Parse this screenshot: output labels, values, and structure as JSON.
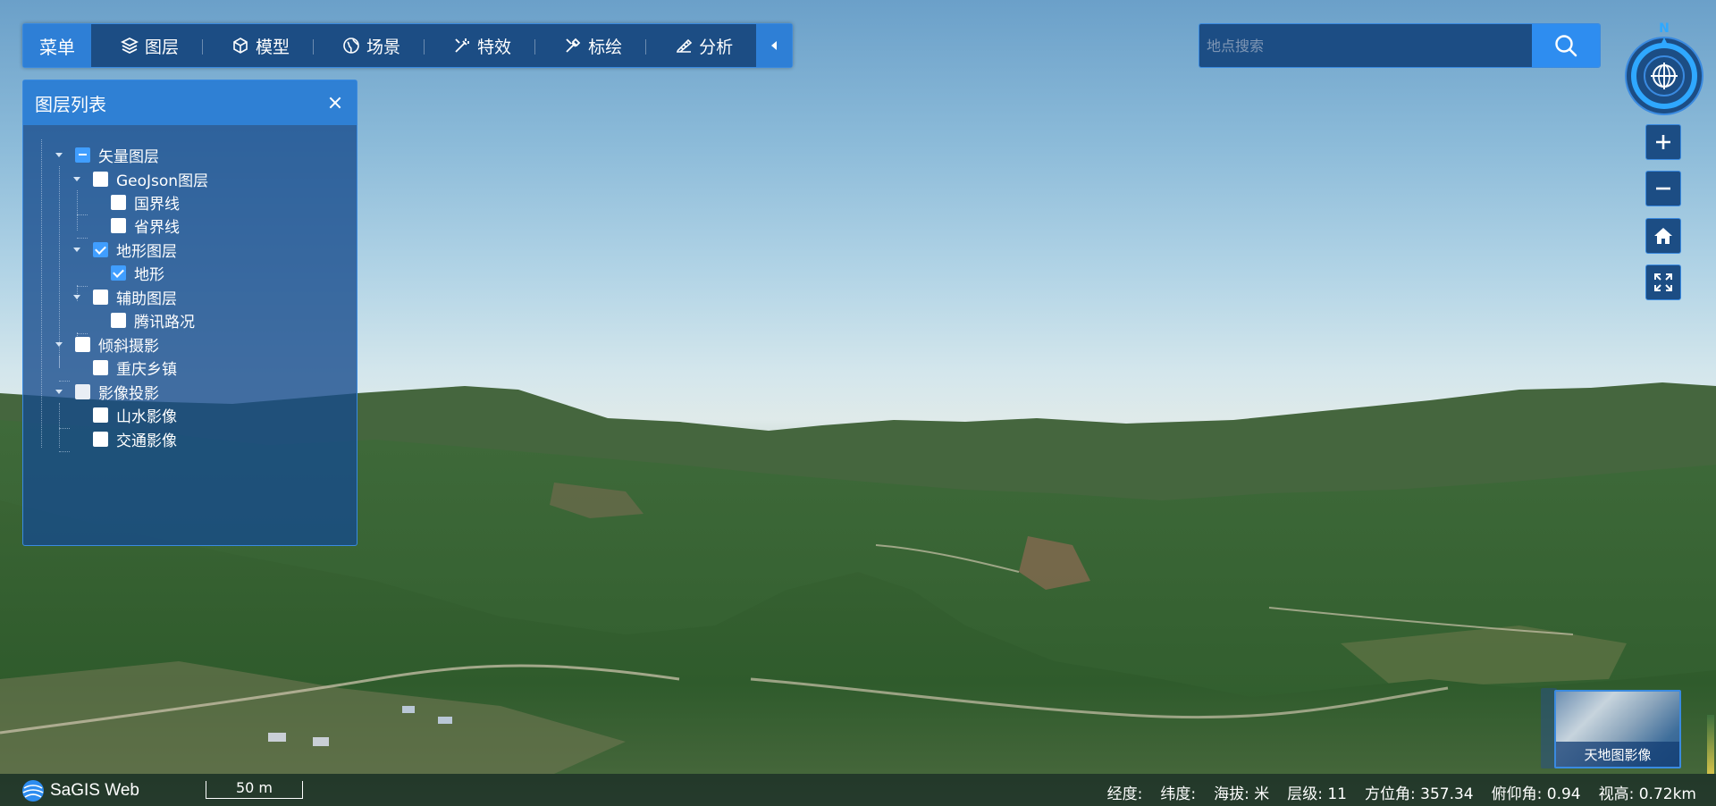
{
  "toolbar": {
    "menu": "菜单",
    "items": [
      {
        "label": "图层",
        "icon": "layers-icon"
      },
      {
        "label": "模型",
        "icon": "cube-icon"
      },
      {
        "label": "场景",
        "icon": "globe-icon"
      },
      {
        "label": "特效",
        "icon": "effects-icon"
      },
      {
        "label": "标绘",
        "icon": "plot-icon"
      },
      {
        "label": "分析",
        "icon": "ruler-icon"
      }
    ]
  },
  "panel": {
    "title": "图层列表",
    "tree": [
      {
        "label": "矢量图层",
        "state": "partial",
        "level": 0,
        "expanded": true
      },
      {
        "label": "GeoJson图层",
        "state": "unchecked",
        "level": 1,
        "expanded": true
      },
      {
        "label": "国界线",
        "state": "unchecked",
        "level": 2
      },
      {
        "label": "省界线",
        "state": "unchecked",
        "level": 2
      },
      {
        "label": "地形图层",
        "state": "checked",
        "level": 1,
        "expanded": true
      },
      {
        "label": "地形",
        "state": "checked",
        "level": 2
      },
      {
        "label": "辅助图层",
        "state": "unchecked",
        "level": 1,
        "expanded": true
      },
      {
        "label": "腾讯路况",
        "state": "unchecked",
        "level": 2
      },
      {
        "label": "倾斜摄影",
        "state": "unchecked",
        "level": 0,
        "expanded": true
      },
      {
        "label": "重庆乡镇",
        "state": "unchecked",
        "level": 1
      },
      {
        "label": "影像投影",
        "state": "light",
        "level": 0,
        "expanded": true
      },
      {
        "label": "山水影像",
        "state": "unchecked",
        "level": 1
      },
      {
        "label": "交通影像",
        "state": "unchecked",
        "level": 1
      }
    ]
  },
  "search": {
    "placeholder": "地点搜索"
  },
  "compass": {
    "north": "N"
  },
  "basemap": {
    "label": "天地图影像"
  },
  "status": {
    "logo": "SaGIS Web",
    "scale": "50 m",
    "lon": "经度:",
    "lat": "纬度:",
    "alt": "海拔: 米",
    "level": "层级: 11",
    "heading": "方位角: 357.34",
    "pitch": "俯仰角: 0.94",
    "height": "视高: 0.72km"
  },
  "colors": {
    "accent": "#2e7fd6",
    "panel": "#164a8c",
    "border": "#3a8ae0"
  }
}
